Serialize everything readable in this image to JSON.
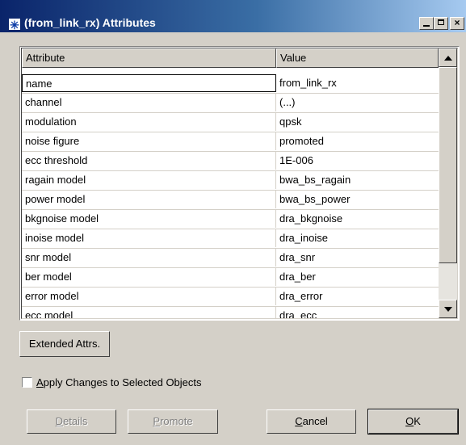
{
  "window": {
    "title": "(from_link_rx) Attributes",
    "icon": "asterisk-icon",
    "controls": {
      "minimize": "minimize-icon",
      "maximize": "maximize-icon",
      "close": "×"
    }
  },
  "table": {
    "headers": {
      "attribute": "Attribute",
      "value": "Value"
    },
    "rows": [
      {
        "attribute": "name",
        "value": "from_link_rx"
      },
      {
        "attribute": "channel",
        "value": "(...)"
      },
      {
        "attribute": "modulation",
        "value": "qpsk"
      },
      {
        "attribute": "noise figure",
        "value": "promoted"
      },
      {
        "attribute": "ecc threshold",
        "value": "1E-006"
      },
      {
        "attribute": "ragain model",
        "value": "bwa_bs_ragain"
      },
      {
        "attribute": "power model",
        "value": "bwa_bs_power"
      },
      {
        "attribute": "bkgnoise model",
        "value": "dra_bkgnoise"
      },
      {
        "attribute": "inoise model",
        "value": "dra_inoise"
      },
      {
        "attribute": "snr model",
        "value": "dra_snr"
      },
      {
        "attribute": "ber model",
        "value": "dra_ber"
      },
      {
        "attribute": "error model",
        "value": "dra_error"
      },
      {
        "attribute": "ecc model",
        "value": "dra_ecc"
      }
    ],
    "selected_index": 0
  },
  "buttons": {
    "extended": "Extended Attrs.",
    "details": {
      "mnemonic": "D",
      "rest": "etails"
    },
    "promote": {
      "mnemonic": "P",
      "rest": "romote"
    },
    "cancel": {
      "mnemonic": "C",
      "rest": "ancel"
    },
    "ok": {
      "mnemonic": "O",
      "rest": "K"
    }
  },
  "apply_changes": {
    "mnemonic": "A",
    "rest": "pply Changes to Selected Objects",
    "checked": false
  },
  "colors": {
    "dialog_bg": "#d4d0c8",
    "title_gradient_start": "#0a246a",
    "title_gradient_end": "#a6caf0"
  }
}
